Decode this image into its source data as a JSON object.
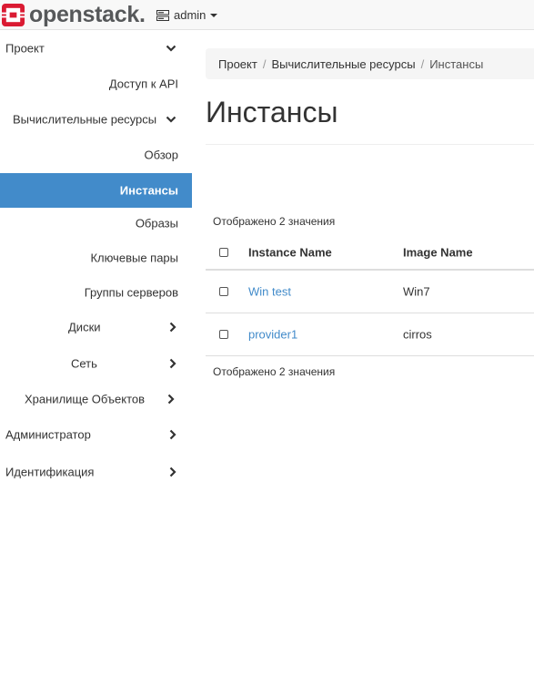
{
  "brand": {
    "name": "openstack.",
    "logo_color": "#da1a32"
  },
  "header": {
    "project_label": "admin"
  },
  "sidebar": {
    "items": [
      {
        "label": "Проект",
        "icon": "chevron-down-icon"
      },
      {
        "label": "Доступ к API"
      },
      {
        "label": "Вычислительные ресурсы",
        "icon": "chevron-down-icon"
      },
      {
        "label": "Обзор"
      },
      {
        "label": "Инстансы",
        "active": true
      },
      {
        "label": "Образы"
      },
      {
        "label": "Ключевые пары"
      },
      {
        "label": "Группы серверов"
      },
      {
        "label": "Диски",
        "icon": "chevron-right-icon"
      },
      {
        "label": "Сеть",
        "icon": "chevron-right-icon"
      },
      {
        "label": "Хранилище Объектов",
        "icon": "chevron-right-icon"
      },
      {
        "label": "Администратор",
        "icon": "chevron-right-icon"
      },
      {
        "label": "Идентификация",
        "icon": "chevron-right-icon"
      }
    ],
    "active_color": "#428bca"
  },
  "breadcrumb": [
    "Проект",
    "Вычислительные ресурсы",
    "Инстансы"
  ],
  "page_title": "Инстансы",
  "table": {
    "count_top": "Отображено 2 значения",
    "count_bottom": "Отображено 2 значения",
    "columns": [
      "Instance Name",
      "Image Name"
    ],
    "rows": [
      {
        "instance_name": "Win test",
        "image_name": "Win7"
      },
      {
        "instance_name": "provider1",
        "image_name": "cirros"
      }
    ],
    "link_color": "#428bca"
  }
}
